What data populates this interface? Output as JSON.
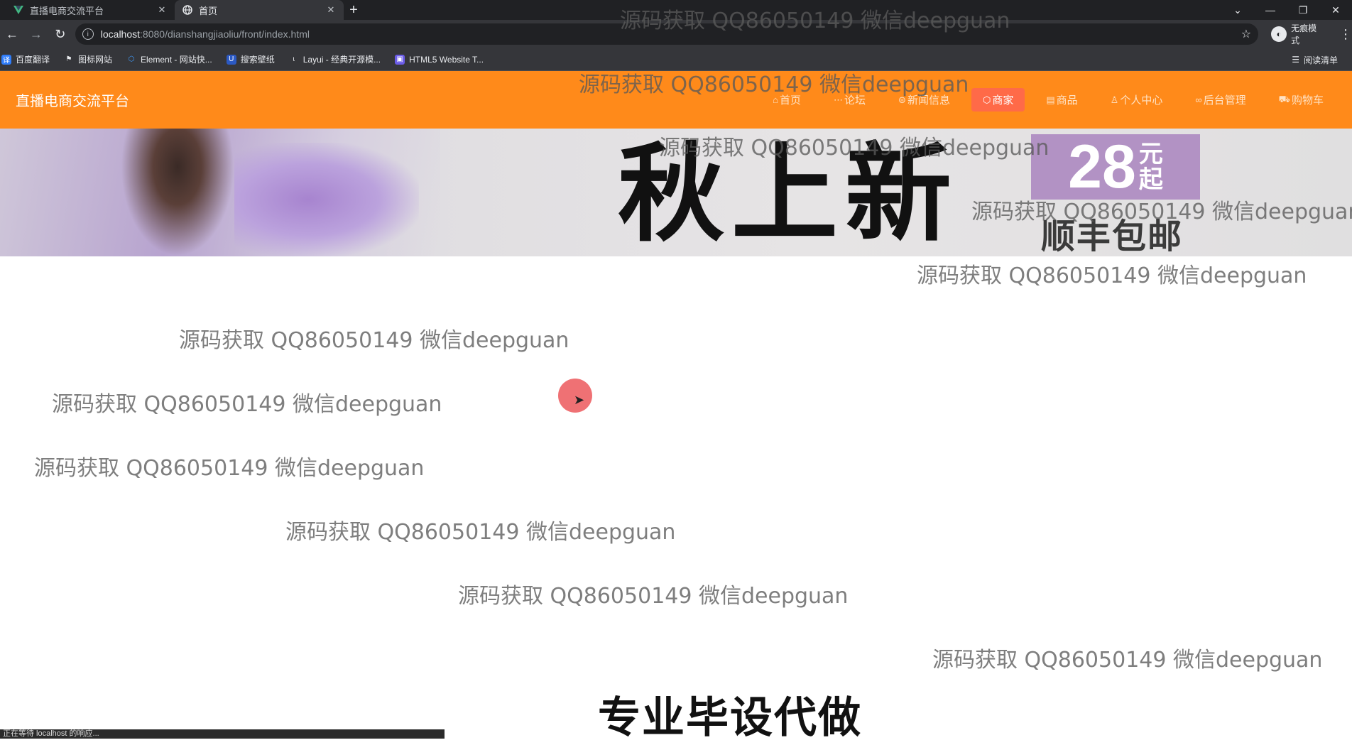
{
  "browser": {
    "tabs": [
      {
        "title": "直播电商交流平台",
        "icon": "vue-logo-icon",
        "active": false
      },
      {
        "title": "首页",
        "icon": "globe-icon",
        "active": true
      }
    ],
    "new_tab_label": "+",
    "url_host": "localhost",
    "url_path": ":8080/dianshangjiaoliu/front/index.html",
    "incognito_label": "无痕模式",
    "bookmarks": [
      {
        "label": "百度翻译",
        "icon": "translate-icon",
        "color": "#2f7dfa"
      },
      {
        "label": "图标网站",
        "icon": "flag-icon",
        "color": "#3c3c3c"
      },
      {
        "label": "Element - 网站快...",
        "icon": "element-icon",
        "color": "#409eff"
      },
      {
        "label": "搜索壁纸",
        "icon": "wallpaper-icon",
        "color": "#2b59c3"
      },
      {
        "label": "Layui - 经典开源模...",
        "icon": "layui-icon",
        "color": "#3c3c3c"
      },
      {
        "label": "HTML5 Website T...",
        "icon": "html5-icon",
        "color": "#6b5ce7"
      }
    ],
    "reading_list_label": "阅读清单",
    "status_text": "正在等待 localhost 的响应..."
  },
  "site": {
    "brand": "直播电商交流平台",
    "accent_color": "#ff8a1a",
    "menu": [
      {
        "label": "首页",
        "icon": "home-icon",
        "active": false
      },
      {
        "label": "论坛",
        "icon": "forum-icon",
        "active": false
      },
      {
        "label": "新闻信息",
        "icon": "news-icon",
        "active": false
      },
      {
        "label": "商家",
        "icon": "shop-icon",
        "active": true
      },
      {
        "label": "商品",
        "icon": "goods-icon",
        "active": false
      },
      {
        "label": "个人中心",
        "icon": "user-icon",
        "active": false
      },
      {
        "label": "后台管理",
        "icon": "link-icon",
        "active": false
      },
      {
        "label": "购物车",
        "icon": "cart-icon",
        "active": false
      }
    ],
    "banner": {
      "slogan": "秋上新",
      "price_number": "28",
      "price_unit_1": "元",
      "price_unit_2": "起",
      "shipping": "顺丰包邮"
    }
  },
  "overlay": {
    "watermark_text": "源码获取 QQ86050149 微信deepguan",
    "promo_text": "专业毕设代做"
  }
}
